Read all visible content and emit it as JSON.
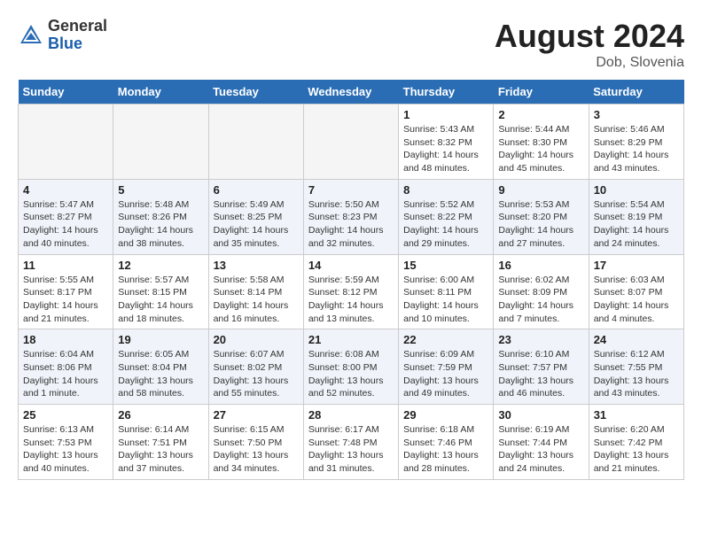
{
  "header": {
    "logo_general": "General",
    "logo_blue": "Blue",
    "month_year": "August 2024",
    "location": "Dob, Slovenia"
  },
  "days_of_week": [
    "Sunday",
    "Monday",
    "Tuesday",
    "Wednesday",
    "Thursday",
    "Friday",
    "Saturday"
  ],
  "weeks": [
    [
      {
        "day": "",
        "detail": ""
      },
      {
        "day": "",
        "detail": ""
      },
      {
        "day": "",
        "detail": ""
      },
      {
        "day": "",
        "detail": ""
      },
      {
        "day": "1",
        "detail": "Sunrise: 5:43 AM\nSunset: 8:32 PM\nDaylight: 14 hours\nand 48 minutes."
      },
      {
        "day": "2",
        "detail": "Sunrise: 5:44 AM\nSunset: 8:30 PM\nDaylight: 14 hours\nand 45 minutes."
      },
      {
        "day": "3",
        "detail": "Sunrise: 5:46 AM\nSunset: 8:29 PM\nDaylight: 14 hours\nand 43 minutes."
      }
    ],
    [
      {
        "day": "4",
        "detail": "Sunrise: 5:47 AM\nSunset: 8:27 PM\nDaylight: 14 hours\nand 40 minutes."
      },
      {
        "day": "5",
        "detail": "Sunrise: 5:48 AM\nSunset: 8:26 PM\nDaylight: 14 hours\nand 38 minutes."
      },
      {
        "day": "6",
        "detail": "Sunrise: 5:49 AM\nSunset: 8:25 PM\nDaylight: 14 hours\nand 35 minutes."
      },
      {
        "day": "7",
        "detail": "Sunrise: 5:50 AM\nSunset: 8:23 PM\nDaylight: 14 hours\nand 32 minutes."
      },
      {
        "day": "8",
        "detail": "Sunrise: 5:52 AM\nSunset: 8:22 PM\nDaylight: 14 hours\nand 29 minutes."
      },
      {
        "day": "9",
        "detail": "Sunrise: 5:53 AM\nSunset: 8:20 PM\nDaylight: 14 hours\nand 27 minutes."
      },
      {
        "day": "10",
        "detail": "Sunrise: 5:54 AM\nSunset: 8:19 PM\nDaylight: 14 hours\nand 24 minutes."
      }
    ],
    [
      {
        "day": "11",
        "detail": "Sunrise: 5:55 AM\nSunset: 8:17 PM\nDaylight: 14 hours\nand 21 minutes."
      },
      {
        "day": "12",
        "detail": "Sunrise: 5:57 AM\nSunset: 8:15 PM\nDaylight: 14 hours\nand 18 minutes."
      },
      {
        "day": "13",
        "detail": "Sunrise: 5:58 AM\nSunset: 8:14 PM\nDaylight: 14 hours\nand 16 minutes."
      },
      {
        "day": "14",
        "detail": "Sunrise: 5:59 AM\nSunset: 8:12 PM\nDaylight: 14 hours\nand 13 minutes."
      },
      {
        "day": "15",
        "detail": "Sunrise: 6:00 AM\nSunset: 8:11 PM\nDaylight: 14 hours\nand 10 minutes."
      },
      {
        "day": "16",
        "detail": "Sunrise: 6:02 AM\nSunset: 8:09 PM\nDaylight: 14 hours\nand 7 minutes."
      },
      {
        "day": "17",
        "detail": "Sunrise: 6:03 AM\nSunset: 8:07 PM\nDaylight: 14 hours\nand 4 minutes."
      }
    ],
    [
      {
        "day": "18",
        "detail": "Sunrise: 6:04 AM\nSunset: 8:06 PM\nDaylight: 14 hours\nand 1 minute."
      },
      {
        "day": "19",
        "detail": "Sunrise: 6:05 AM\nSunset: 8:04 PM\nDaylight: 13 hours\nand 58 minutes."
      },
      {
        "day": "20",
        "detail": "Sunrise: 6:07 AM\nSunset: 8:02 PM\nDaylight: 13 hours\nand 55 minutes."
      },
      {
        "day": "21",
        "detail": "Sunrise: 6:08 AM\nSunset: 8:00 PM\nDaylight: 13 hours\nand 52 minutes."
      },
      {
        "day": "22",
        "detail": "Sunrise: 6:09 AM\nSunset: 7:59 PM\nDaylight: 13 hours\nand 49 minutes."
      },
      {
        "day": "23",
        "detail": "Sunrise: 6:10 AM\nSunset: 7:57 PM\nDaylight: 13 hours\nand 46 minutes."
      },
      {
        "day": "24",
        "detail": "Sunrise: 6:12 AM\nSunset: 7:55 PM\nDaylight: 13 hours\nand 43 minutes."
      }
    ],
    [
      {
        "day": "25",
        "detail": "Sunrise: 6:13 AM\nSunset: 7:53 PM\nDaylight: 13 hours\nand 40 minutes."
      },
      {
        "day": "26",
        "detail": "Sunrise: 6:14 AM\nSunset: 7:51 PM\nDaylight: 13 hours\nand 37 minutes."
      },
      {
        "day": "27",
        "detail": "Sunrise: 6:15 AM\nSunset: 7:50 PM\nDaylight: 13 hours\nand 34 minutes."
      },
      {
        "day": "28",
        "detail": "Sunrise: 6:17 AM\nSunset: 7:48 PM\nDaylight: 13 hours\nand 31 minutes."
      },
      {
        "day": "29",
        "detail": "Sunrise: 6:18 AM\nSunset: 7:46 PM\nDaylight: 13 hours\nand 28 minutes."
      },
      {
        "day": "30",
        "detail": "Sunrise: 6:19 AM\nSunset: 7:44 PM\nDaylight: 13 hours\nand 24 minutes."
      },
      {
        "day": "31",
        "detail": "Sunrise: 6:20 AM\nSunset: 7:42 PM\nDaylight: 13 hours\nand 21 minutes."
      }
    ]
  ]
}
